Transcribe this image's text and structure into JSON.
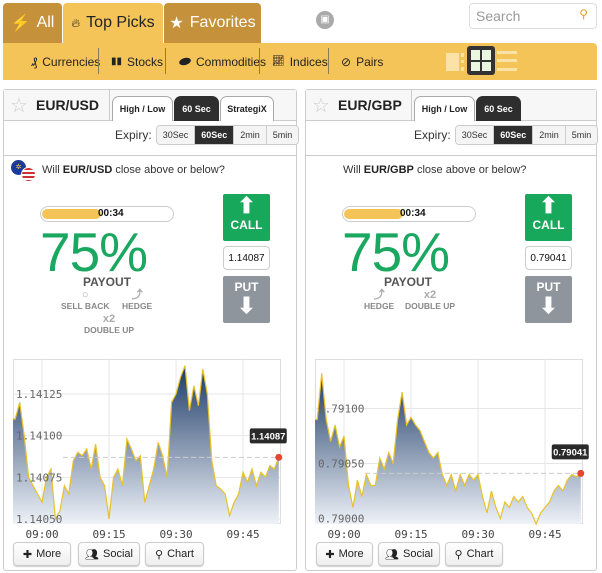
{
  "top_tabs": [
    {
      "label": "All",
      "icon": "lightning-icon"
    },
    {
      "label": "Top Picks",
      "icon": "flame-icon",
      "active": true
    },
    {
      "label": "Favorites",
      "icon": "star-icon"
    }
  ],
  "search": {
    "placeholder": "Search"
  },
  "categories": [
    {
      "label": "Currencies",
      "icon": "currencies-icon"
    },
    {
      "label": "Stocks",
      "icon": "stocks-icon"
    },
    {
      "label": "Commodities",
      "icon": "commodities-icon"
    },
    {
      "label": "Indices",
      "icon": "indices-icon"
    },
    {
      "label": "Pairs",
      "icon": "pairs-icon"
    }
  ],
  "view_modes": [
    "sidebar-view",
    "grid-view",
    "list-view"
  ],
  "active_view": "grid-view",
  "colors": {
    "accent": "#f5c458",
    "tab_dark": "#c5913b",
    "call": "#18a85c",
    "put": "#8e959c",
    "payout": "#1aa760",
    "marker": "#e8442e"
  },
  "panels": [
    {
      "asset": "EUR/USD",
      "tabs": [
        "High / Low",
        "60 Sec",
        "StrategiX"
      ],
      "active_tab": "60 Sec",
      "expiry_label": "Expiry:",
      "expiry_options": [
        "30Sec",
        "60Sec",
        "2min",
        "5min"
      ],
      "expiry_selected": "60Sec",
      "question_prefix": "Will ",
      "question_asset": "EUR/USD",
      "question_suffix": " close above or below?",
      "timer": "00:34",
      "timer_progress": 0.45,
      "payout_pct": "75%",
      "payout_label": "PAYOUT",
      "features": [
        "SELL BACK",
        "HEDGE",
        "DOUBLE UP"
      ],
      "double_up_mark": "x2",
      "call_label": "CALL",
      "put_label": "PUT",
      "price": "1.14087",
      "buttons": [
        "More",
        "Social",
        "Chart"
      ]
    },
    {
      "asset": "EUR/GBP",
      "tabs": [
        "High / Low",
        "60 Sec"
      ],
      "active_tab": "60 Sec",
      "expiry_label": "Expiry:",
      "expiry_options": [
        "30Sec",
        "60Sec",
        "2min",
        "5min"
      ],
      "expiry_selected": "60Sec",
      "question_prefix": "Will ",
      "question_asset": "EUR/GBP",
      "question_suffix": " close above or below?",
      "timer": "00:34",
      "timer_progress": 0.45,
      "payout_pct": "75%",
      "payout_label": "PAYOUT",
      "features": [
        "HEDGE",
        "DOUBLE UP"
      ],
      "double_up_mark": "x2",
      "call_label": "CALL",
      "put_label": "PUT",
      "price": "0.79041",
      "buttons": [
        "More",
        "Social",
        "Chart"
      ]
    }
  ],
  "chart_data": [
    {
      "type": "area",
      "x_ticks": [
        "09:00",
        "09:15",
        "09:30",
        "09:45"
      ],
      "y_ticks": [
        "1.14050",
        "1.14075",
        "1.14100",
        "1.14125"
      ],
      "y_tick_values": [
        1.1405,
        1.14075,
        1.141,
        1.14125
      ],
      "ylim": [
        1.14047,
        1.14146
      ],
      "xlim": [
        "08:53.5",
        "09:53.5"
      ],
      "grid": true,
      "last_value_label": "1.14087",
      "x": [
        "08:54",
        "08:55",
        "08:56",
        "08:57",
        "08:58",
        "08:59",
        "09:00",
        "09:01",
        "09:02",
        "09:03",
        "09:04",
        "09:05",
        "09:06",
        "09:07",
        "09:08",
        "09:09",
        "09:10",
        "09:11",
        "09:12",
        "09:13",
        "09:14",
        "09:15",
        "09:16",
        "09:17",
        "09:18",
        "09:19",
        "09:20",
        "09:21",
        "09:22",
        "09:23",
        "09:24",
        "09:25",
        "09:26",
        "09:27",
        "09:28",
        "09:29",
        "09:30",
        "09:31",
        "09:32",
        "09:33",
        "09:34",
        "09:35",
        "09:36",
        "09:37",
        "09:38",
        "09:39",
        "09:40",
        "09:41",
        "09:42",
        "09:43",
        "09:44",
        "09:45",
        "09:46",
        "09:47",
        "09:48",
        "09:49",
        "09:50",
        "09:51",
        "09:52",
        "09:53"
      ],
      "values": [
        1.1411,
        1.1412,
        1.141,
        1.14075,
        1.1407,
        1.14065,
        1.1406,
        1.14075,
        1.1408,
        1.1405,
        1.14055,
        1.1407,
        1.14065,
        1.14085,
        1.1409,
        1.14088,
        1.14092,
        1.1408,
        1.14095,
        1.14075,
        1.1407,
        1.1405,
        1.14075,
        1.1408,
        1.1407,
        1.14098,
        1.14092,
        1.14085,
        1.14088,
        1.1406,
        1.1407,
        1.1408,
        1.14096,
        1.14088,
        1.14075,
        1.1412,
        1.14125,
        1.14135,
        1.14142,
        1.14115,
        1.1413,
        1.14118,
        1.1414,
        1.14125,
        1.14085,
        1.1407,
        1.14068,
        1.14065,
        1.14052,
        1.1406,
        1.14065,
        1.14078,
        1.14072,
        1.1408,
        1.1407,
        1.14078,
        1.14075,
        1.14082,
        1.1408,
        1.14087
      ]
    },
    {
      "type": "area",
      "x_ticks": [
        "09:00",
        "09:15",
        "09:30",
        "09:45"
      ],
      "y_ticks": [
        "0.79000",
        "0.79050",
        "0.79100"
      ],
      "y_tick_values": [
        0.79,
        0.7905,
        0.791
      ],
      "ylim": [
        0.78995,
        0.79145
      ],
      "xlim": [
        "08:53.5",
        "09:53.5"
      ],
      "grid": true,
      "last_value_label": "0.79041",
      "x": [
        "08:54",
        "08:55",
        "08:56",
        "08:57",
        "08:58",
        "08:59",
        "09:00",
        "09:01",
        "09:02",
        "09:03",
        "09:04",
        "09:05",
        "09:06",
        "09:07",
        "09:08",
        "09:09",
        "09:10",
        "09:11",
        "09:12",
        "09:13",
        "09:14",
        "09:15",
        "09:16",
        "09:17",
        "09:18",
        "09:19",
        "09:20",
        "09:21",
        "09:22",
        "09:23",
        "09:24",
        "09:25",
        "09:26",
        "09:27",
        "09:28",
        "09:29",
        "09:30",
        "09:31",
        "09:32",
        "09:33",
        "09:34",
        "09:35",
        "09:36",
        "09:37",
        "09:38",
        "09:39",
        "09:40",
        "09:41",
        "09:42",
        "09:43",
        "09:44",
        "09:45",
        "09:46",
        "09:47",
        "09:48",
        "09:49",
        "09:50",
        "09:51",
        "09:52",
        "09:53"
      ],
      "values": [
        0.7909,
        0.79132,
        0.7909,
        0.7907,
        0.79085,
        0.79065,
        0.79075,
        0.7903,
        0.7901,
        0.79035,
        0.7902,
        0.7904,
        0.7903,
        0.7903,
        0.79055,
        0.79045,
        0.7906,
        0.7905,
        0.7909,
        0.79115,
        0.79085,
        0.79092,
        0.79085,
        0.7908,
        0.7907,
        0.7906,
        0.79055,
        0.7906,
        0.7904,
        0.7903,
        0.7904,
        0.79025,
        0.7904,
        0.7903,
        0.7904,
        0.79035,
        0.7904,
        0.7902,
        0.79005,
        0.79025,
        0.7901,
        0.79,
        0.79015,
        0.7901,
        0.7902,
        0.79015,
        0.7902,
        0.7901,
        0.79005,
        0.78995,
        0.79005,
        0.7901,
        0.79015,
        0.79025,
        0.7903,
        0.79025,
        0.79035,
        0.7904,
        0.79038,
        0.79041
      ]
    }
  ]
}
